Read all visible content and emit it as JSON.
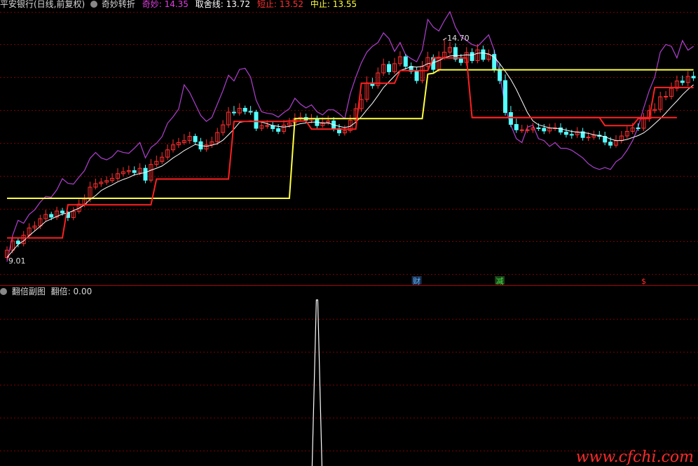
{
  "main_panel": {
    "header": {
      "stock": "平安银行(日线,前复权)",
      "indicator": "奇妙转折",
      "items": [
        {
          "label": "奇妙",
          "value": "14.35",
          "color": "#e040e0"
        },
        {
          "label": "取舍线",
          "value": "13.72",
          "color": "#ffffff"
        },
        {
          "label": "短止",
          "value": "13.52",
          "color": "#ff3030"
        },
        {
          "label": "中止",
          "value": "13.55",
          "color": "#ffff40"
        }
      ]
    },
    "high_label": "14.70",
    "low_label": "9.01",
    "markers": [
      {
        "text": "财",
        "color": "#5ab4ff",
        "bg": "#1a3050"
      },
      {
        "text": "减",
        "color": "#40e040",
        "bg": "#1a401a"
      },
      {
        "text": "$",
        "color": "#ff3030",
        "bg": ""
      }
    ]
  },
  "sub_panel": {
    "title": "翻倍副图",
    "label": "翻倍",
    "value": "0.00"
  },
  "watermark": "www.cfchi.com",
  "colors": {
    "background": "#000000",
    "grid": "#7a0000",
    "up": "#ff3030",
    "down": "#54ffff",
    "purple": "#b040d0",
    "white_line": "#ffffff",
    "yellow": "#ffff40",
    "red_step": "#ff2020"
  },
  "chart_data": {
    "type": "candlestick",
    "n": 125,
    "ylim": [
      8.6,
      15.45
    ],
    "candles": {
      "open": [
        9.01,
        9.2,
        9.44,
        9.37,
        9.59,
        9.78,
        9.83,
        10.02,
        10.13,
        10.06,
        10.22,
        10.17,
        10.05,
        10.21,
        10.4,
        10.53,
        10.84,
        10.93,
        10.97,
        11.01,
        11.07,
        11.19,
        11.24,
        11.27,
        11.22,
        11.33,
        11.02,
        11.43,
        11.51,
        11.62,
        11.81,
        11.94,
        12.0,
        12.05,
        12.16,
        12.02,
        11.83,
        11.94,
        12.02,
        12.26,
        12.46,
        12.79,
        12.77,
        12.89,
        12.81,
        12.79,
        12.37,
        12.44,
        12.44,
        12.36,
        12.29,
        12.45,
        12.51,
        12.62,
        12.65,
        12.58,
        12.62,
        12.44,
        12.52,
        12.56,
        12.36,
        12.25,
        12.31,
        12.58,
        12.88,
        13.12,
        13.55,
        13.48,
        13.81,
        14.03,
        13.84,
        14.05,
        14.23,
        13.98,
        13.85,
        13.61,
        13.98,
        14.21,
        13.9,
        14.22,
        14.35,
        14.47,
        14.17,
        14.08,
        14.34,
        14.13,
        14.41,
        14.16,
        14.29,
        13.9,
        13.61,
        12.78,
        12.47,
        12.33,
        12.33,
        12.33,
        12.38,
        12.37,
        12.3,
        12.37,
        12.38,
        12.27,
        12.21,
        12.2,
        12.28,
        12.13,
        12.14,
        12.19,
        12.16,
        12.01,
        11.93,
        12.05,
        12.17,
        12.29,
        12.38,
        12.37,
        12.62,
        12.83,
        12.86,
        13.19,
        13.2,
        13.41,
        13.6,
        13.56,
        13.72
      ],
      "close": [
        9.2,
        9.44,
        9.37,
        9.59,
        9.78,
        9.83,
        10.02,
        10.13,
        10.06,
        10.22,
        10.17,
        10.05,
        10.21,
        10.4,
        10.53,
        10.84,
        10.93,
        10.97,
        11.01,
        11.07,
        11.19,
        11.24,
        11.27,
        11.22,
        11.33,
        11.02,
        11.43,
        11.51,
        11.62,
        11.81,
        11.94,
        12.0,
        12.05,
        12.16,
        12.02,
        11.83,
        11.94,
        12.02,
        12.26,
        12.46,
        12.79,
        12.77,
        12.89,
        12.81,
        12.79,
        12.37,
        12.44,
        12.44,
        12.36,
        12.29,
        12.45,
        12.51,
        12.62,
        12.65,
        12.58,
        12.62,
        12.44,
        12.52,
        12.56,
        12.36,
        12.25,
        12.31,
        12.58,
        12.88,
        13.12,
        13.55,
        13.48,
        13.81,
        14.03,
        13.84,
        14.05,
        14.23,
        13.98,
        13.85,
        13.61,
        13.98,
        14.21,
        13.9,
        14.22,
        14.35,
        14.47,
        14.17,
        14.08,
        14.34,
        14.13,
        14.41,
        14.16,
        14.29,
        13.9,
        13.61,
        12.78,
        12.47,
        12.33,
        12.33,
        12.33,
        12.38,
        12.37,
        12.3,
        12.37,
        12.38,
        12.27,
        12.21,
        12.2,
        12.28,
        12.13,
        12.14,
        12.19,
        12.16,
        12.01,
        11.93,
        12.05,
        12.17,
        12.29,
        12.38,
        12.37,
        12.62,
        12.83,
        12.86,
        13.19,
        13.2,
        13.41,
        13.6,
        13.56,
        13.72,
        13.68
      ],
      "high": [
        9.3,
        9.55,
        9.5,
        9.7,
        9.9,
        9.95,
        10.12,
        10.25,
        10.2,
        10.33,
        10.3,
        10.22,
        10.32,
        10.52,
        10.65,
        10.98,
        11.06,
        11.08,
        11.12,
        11.2,
        11.33,
        11.36,
        11.4,
        11.38,
        11.46,
        11.42,
        11.57,
        11.66,
        11.75,
        11.95,
        12.08,
        12.12,
        12.22,
        12.28,
        12.23,
        12.12,
        12.08,
        12.15,
        12.38,
        12.58,
        12.92,
        12.95,
        13.02,
        12.96,
        12.95,
        12.85,
        12.56,
        12.58,
        12.55,
        12.48,
        12.58,
        12.64,
        12.76,
        12.78,
        12.75,
        12.74,
        12.7,
        12.65,
        12.7,
        12.66,
        12.48,
        12.45,
        12.72,
        13.02,
        13.26,
        13.72,
        13.68,
        13.95,
        14.18,
        14.12,
        14.2,
        14.37,
        14.3,
        14.08,
        13.96,
        14.12,
        14.36,
        14.29,
        14.37,
        14.7,
        14.62,
        14.58,
        14.3,
        14.48,
        14.45,
        14.56,
        14.52,
        14.42,
        14.41,
        14.05,
        13.77,
        12.95,
        12.62,
        12.46,
        12.46,
        12.51,
        12.5,
        12.48,
        12.49,
        12.51,
        12.5,
        12.38,
        12.33,
        12.4,
        12.38,
        12.27,
        12.31,
        12.3,
        12.28,
        12.14,
        12.19,
        12.3,
        12.42,
        12.51,
        12.5,
        12.77,
        12.98,
        13.02,
        13.32,
        13.34,
        13.56,
        13.74,
        13.74,
        13.86,
        13.85
      ],
      "low": [
        8.95,
        9.12,
        9.28,
        9.3,
        9.5,
        9.7,
        9.75,
        9.94,
        9.98,
        9.99,
        10.1,
        9.96,
        9.98,
        10.15,
        10.32,
        10.45,
        10.78,
        10.85,
        10.9,
        10.95,
        11.0,
        11.12,
        11.16,
        11.14,
        11.15,
        10.94,
        10.96,
        11.36,
        11.44,
        11.55,
        11.74,
        11.86,
        11.94,
        11.97,
        11.94,
        11.76,
        11.76,
        11.86,
        11.94,
        12.18,
        12.38,
        12.7,
        12.7,
        12.73,
        12.72,
        12.3,
        12.3,
        12.36,
        12.28,
        12.22,
        12.22,
        12.38,
        12.44,
        12.55,
        12.52,
        12.5,
        12.37,
        12.38,
        12.45,
        12.29,
        12.17,
        12.18,
        12.25,
        12.5,
        12.8,
        13.05,
        13.4,
        13.4,
        13.73,
        13.76,
        13.78,
        13.98,
        13.9,
        13.78,
        13.53,
        13.54,
        13.9,
        13.82,
        13.83,
        14.15,
        14.28,
        14.1,
        14.0,
        14.0,
        14.06,
        14.06,
        14.1,
        14.1,
        13.82,
        13.52,
        12.7,
        12.4,
        12.25,
        12.25,
        12.25,
        12.25,
        12.3,
        12.22,
        12.23,
        12.3,
        12.2,
        12.13,
        12.1,
        12.12,
        12.05,
        12.04,
        12.07,
        12.08,
        11.93,
        11.85,
        11.87,
        11.98,
        12.1,
        12.22,
        12.3,
        12.3,
        12.54,
        12.76,
        12.78,
        13.1,
        13.12,
        13.33,
        13.48,
        13.46,
        13.6
      ]
    },
    "purple_line": [
      8.9,
      9.58,
      9.98,
      9.9,
      10.13,
      10.25,
      10.45,
      10.6,
      10.58,
      10.77,
      11.06,
      10.94,
      10.92,
      11.1,
      11.27,
      11.59,
      11.74,
      11.6,
      11.55,
      11.63,
      11.79,
      11.74,
      11.72,
      11.85,
      12.0,
      11.6,
      11.87,
      11.98,
      12.15,
      12.5,
      12.67,
      12.87,
      13.5,
      13.3,
      13.0,
      12.7,
      12.55,
      12.65,
      13.0,
      13.35,
      13.75,
      13.6,
      13.9,
      13.93,
      13.7,
      13.1,
      12.8,
      12.76,
      12.74,
      12.66,
      12.78,
      12.88,
      13.15,
      13.0,
      12.9,
      12.98,
      12.8,
      12.72,
      12.85,
      12.85,
      12.75,
      12.62,
      13.27,
      13.7,
      14.07,
      14.35,
      14.5,
      14.6,
      14.85,
      14.7,
      14.37,
      14.6,
      14.28,
      14.18,
      14.1,
      14.4,
      15.2,
      15.0,
      14.9,
      15.17,
      15.4,
      15.0,
      14.75,
      14.65,
      14.55,
      14.5,
      14.65,
      14.8,
      14.4,
      13.8,
      12.9,
      12.45,
      12.1,
      12.0,
      12.4,
      12.45,
      12.1,
      12.05,
      11.9,
      12.0,
      11.85,
      11.85,
      11.8,
      11.7,
      11.6,
      11.45,
      11.35,
      11.3,
      11.35,
      11.3,
      11.5,
      11.6,
      11.8,
      12.05,
      12.4,
      12.9,
      13.35,
      13.7,
      14.35,
      14.55,
      14.5,
      14.2,
      14.65,
      14.4,
      14.5
    ],
    "white_line": [
      9.01,
      9.18,
      9.35,
      9.44,
      9.58,
      9.7,
      9.82,
      9.95,
      10.01,
      10.08,
      10.14,
      10.17,
      10.23,
      10.29,
      10.38,
      10.52,
      10.62,
      10.75,
      10.83,
      10.9,
      10.98,
      11.04,
      11.09,
      11.16,
      11.19,
      11.22,
      11.28,
      11.33,
      11.39,
      11.49,
      11.6,
      11.69,
      11.79,
      11.87,
      11.95,
      11.92,
      11.9,
      11.93,
      11.97,
      12.06,
      12.2,
      12.35,
      12.52,
      12.55,
      12.56,
      12.55,
      12.53,
      12.49,
      12.44,
      12.42,
      12.4,
      12.42,
      12.45,
      12.49,
      12.51,
      12.53,
      12.53,
      12.5,
      12.51,
      12.46,
      12.42,
      12.39,
      12.42,
      12.53,
      12.67,
      12.85,
      13.02,
      13.22,
      13.43,
      13.58,
      13.73,
      13.87,
      13.92,
      13.97,
      13.96,
      13.98,
      14.05,
      14.07,
      14.13,
      14.2,
      14.25,
      14.26,
      14.26,
      14.28,
      14.27,
      14.32,
      14.33,
      14.3,
      14.22,
      14.05,
      13.85,
      13.64,
      13.38,
      13.08,
      12.78,
      12.56,
      12.46,
      12.42,
      12.38,
      12.37,
      12.36,
      12.32,
      12.29,
      12.27,
      12.26,
      12.24,
      12.2,
      12.18,
      12.15,
      12.09,
      12.05,
      12.05,
      12.08,
      12.13,
      12.18,
      12.25,
      12.36,
      12.49,
      12.62,
      12.77,
      12.93,
      13.08,
      13.24,
      13.38,
      13.5
    ],
    "yellow_line": [
      [
        0,
        10.55
      ],
      [
        51,
        10.55
      ],
      [
        52,
        12.62
      ],
      [
        75,
        12.62
      ],
      [
        76,
        13.78
      ],
      [
        77,
        13.8
      ],
      [
        78,
        13.89
      ],
      [
        124,
        13.89
      ]
    ],
    "red_step": [
      [
        0,
        9.52
      ],
      [
        10,
        9.52
      ],
      [
        11,
        10.38
      ],
      [
        26,
        10.38
      ],
      [
        27,
        11.05
      ],
      [
        40,
        11.05
      ],
      [
        41,
        12.55
      ],
      [
        50,
        12.55
      ],
      [
        51,
        12.56
      ],
      [
        54,
        12.56
      ],
      [
        55,
        12.35
      ],
      [
        63,
        12.35
      ],
      [
        64,
        13.54
      ],
      [
        70,
        13.54
      ],
      [
        71,
        13.87
      ],
      [
        76,
        13.87
      ],
      [
        77,
        14.2
      ],
      [
        83,
        14.2
      ],
      [
        84,
        12.65
      ],
      [
        121,
        12.65
      ]
    ],
    "red_step_tail": [
      [
        84,
        12.65
      ],
      [
        107,
        12.65
      ],
      [
        108,
        12.44
      ],
      [
        113,
        12.44
      ],
      [
        114,
        12.62
      ],
      [
        116,
        12.62
      ],
      [
        117,
        13.43
      ],
      [
        124,
        13.43
      ]
    ],
    "sub_spike": {
      "index": 56,
      "value": 1.0
    }
  }
}
